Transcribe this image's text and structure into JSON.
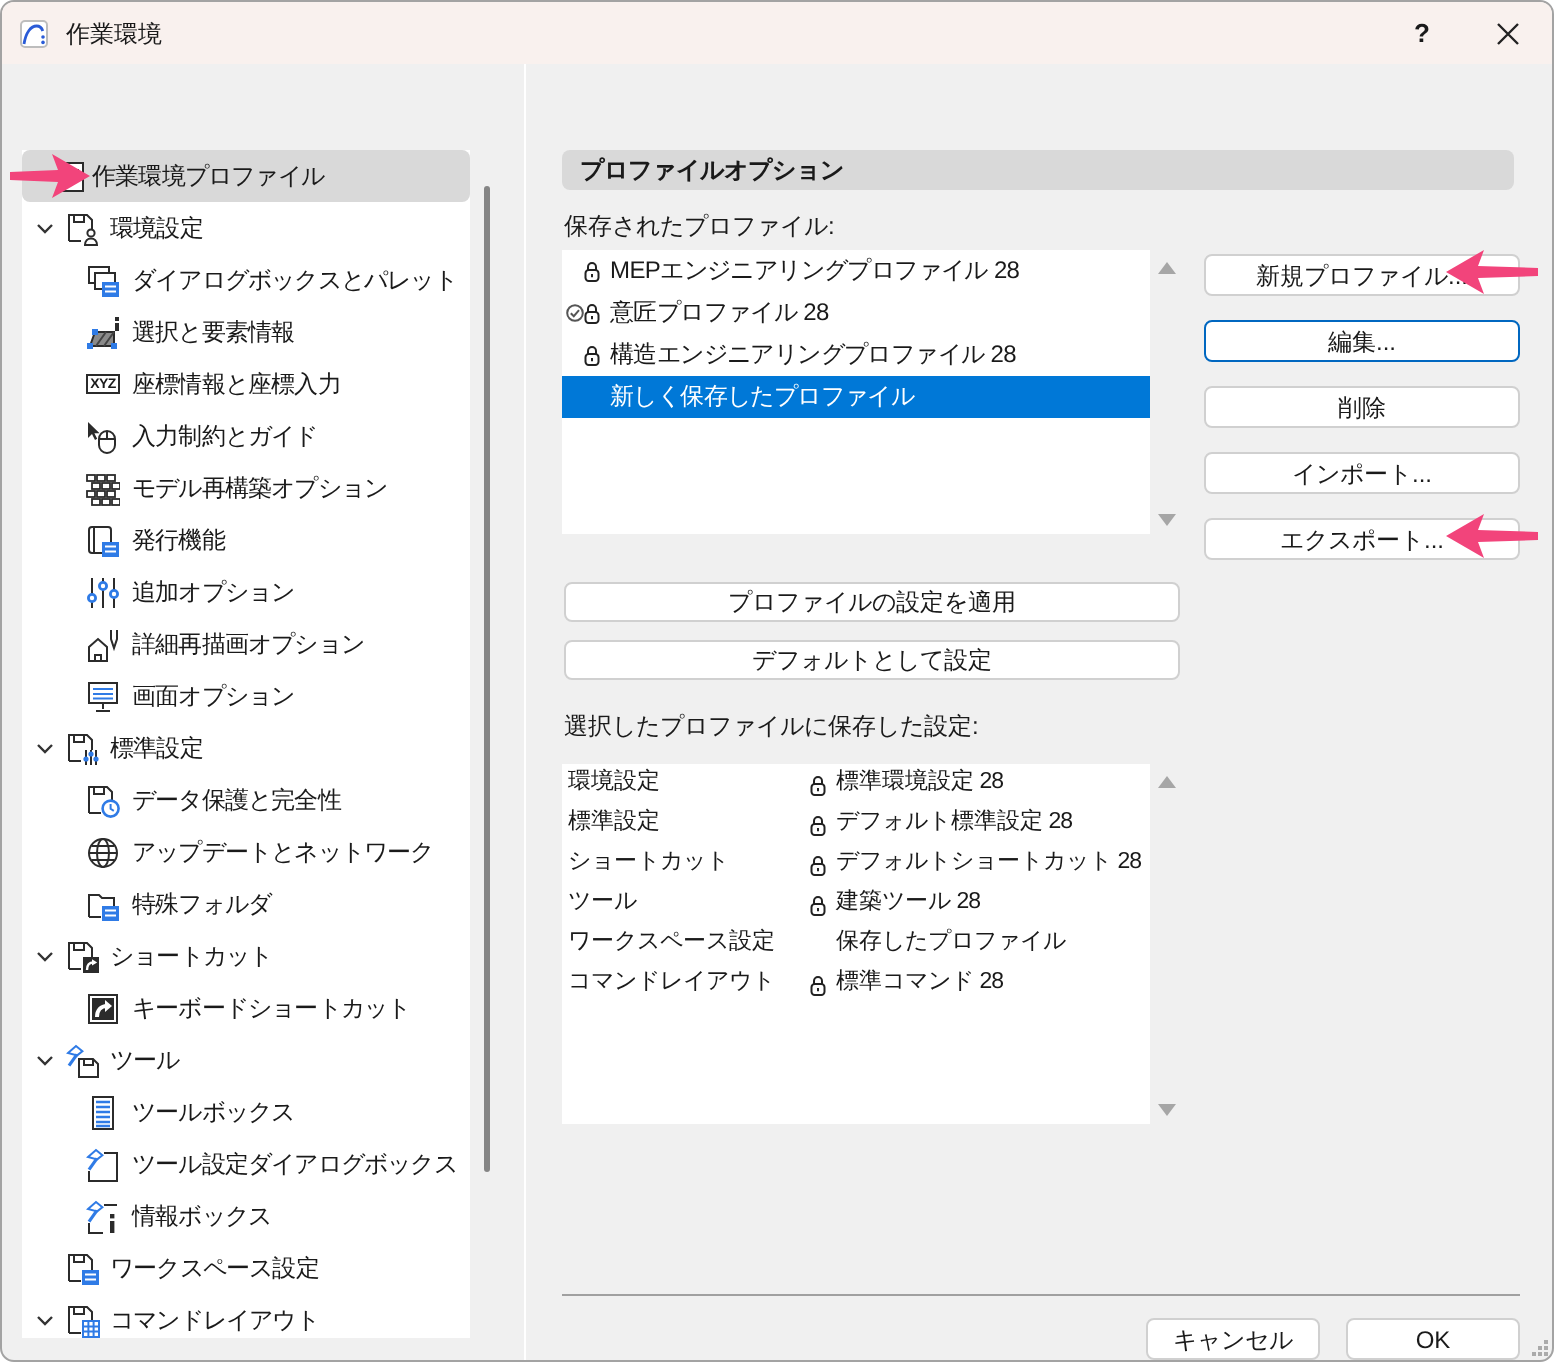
{
  "window": {
    "title": "作業環境",
    "help": "?"
  },
  "sidebar": {
    "items": [
      {
        "kind": "root",
        "label": "作業環境プロファイル",
        "selected": true,
        "callout": true
      },
      {
        "kind": "section",
        "label": "環境設定",
        "selected": false,
        "callout": false,
        "expanded": true,
        "children": [
          {
            "label": "ダイアログボックスとパレット",
            "selected": false
          },
          {
            "label": "選択と要素情報",
            "selected": false
          },
          {
            "label": "座標情報と座標入力",
            "selected": false,
            "badge": "XYZ"
          },
          {
            "label": "入力制約とガイド",
            "selected": false
          },
          {
            "label": "モデル再構築オプション",
            "selected": false
          },
          {
            "label": "発行機能",
            "selected": false
          },
          {
            "label": "追加オプション",
            "selected": false
          },
          {
            "label": "詳細再描画オプション",
            "selected": false
          },
          {
            "label": "画面オプション",
            "selected": false
          }
        ]
      },
      {
        "kind": "section",
        "label": "標準設定",
        "selected": false,
        "callout": false,
        "expanded": true,
        "children": [
          {
            "label": "データ保護と完全性",
            "selected": false
          },
          {
            "label": "アップデートとネットワーク",
            "selected": false
          },
          {
            "label": "特殊フォルダ",
            "selected": false
          }
        ]
      },
      {
        "kind": "section",
        "label": "ショートカット",
        "selected": false,
        "callout": false,
        "expanded": true,
        "children": [
          {
            "label": "キーボードショートカット",
            "selected": false
          }
        ]
      },
      {
        "kind": "section",
        "label": "ツール",
        "selected": false,
        "callout": false,
        "expanded": true,
        "children": [
          {
            "label": "ツールボックス",
            "selected": false
          },
          {
            "label": "ツール設定ダイアログボックス",
            "selected": false
          },
          {
            "label": "情報ボックス",
            "selected": false
          }
        ]
      },
      {
        "kind": "section",
        "label": "ワークスペース設定",
        "selected": false,
        "callout": false
      },
      {
        "kind": "section",
        "label": "コマンドレイアウト",
        "selected": false,
        "callout": false,
        "expanded": true
      }
    ]
  },
  "profile_options": {
    "title": "プロファイルオプション",
    "saved_label": "保存されたプロファイル:",
    "saved_profiles": [
      {
        "name": "MEPエンジニアリングプロファイル 28",
        "locked": true,
        "default": false,
        "selected": false
      },
      {
        "name": "意匠プロファイル 28",
        "locked": true,
        "default": true,
        "selected": false
      },
      {
        "name": "構造エンジニアリングプロファイル 28",
        "locked": true,
        "default": false,
        "selected": false
      },
      {
        "name": "新しく保存したプロファイル",
        "locked": false,
        "default": false,
        "selected": true
      }
    ],
    "profile_buttons": [
      {
        "label": "新規プロファイル...",
        "focused": false,
        "callout": true
      },
      {
        "label": "編集...",
        "focused": true,
        "callout": false
      },
      {
        "label": "削除",
        "focused": false,
        "callout": false
      },
      {
        "label": "インポート...",
        "focused": false,
        "callout": false
      },
      {
        "label": "エクスポート...",
        "focused": false,
        "callout": true
      }
    ],
    "apply_buttons": [
      "プロファイルの設定を適用",
      "デフォルトとして設定"
    ],
    "settings_label": "選択したプロファイルに保存した設定:",
    "settings": [
      {
        "category": "環境設定",
        "value": "標準環境設定 28",
        "locked": true
      },
      {
        "category": "標準設定",
        "value": "デフォルト標準設定 28",
        "locked": true
      },
      {
        "category": "ショートカット",
        "value": "デフォルトショートカット 28",
        "locked": true
      },
      {
        "category": "ツール",
        "value": "建築ツール 28",
        "locked": true
      },
      {
        "category": "ワークスペース設定",
        "value": "保存したプロファイル",
        "locked": false
      },
      {
        "category": "コマンドレイアウト",
        "value": "標準コマンド 28",
        "locked": true
      }
    ]
  },
  "footer_buttons": [
    "キャンセル",
    "OK"
  ]
}
